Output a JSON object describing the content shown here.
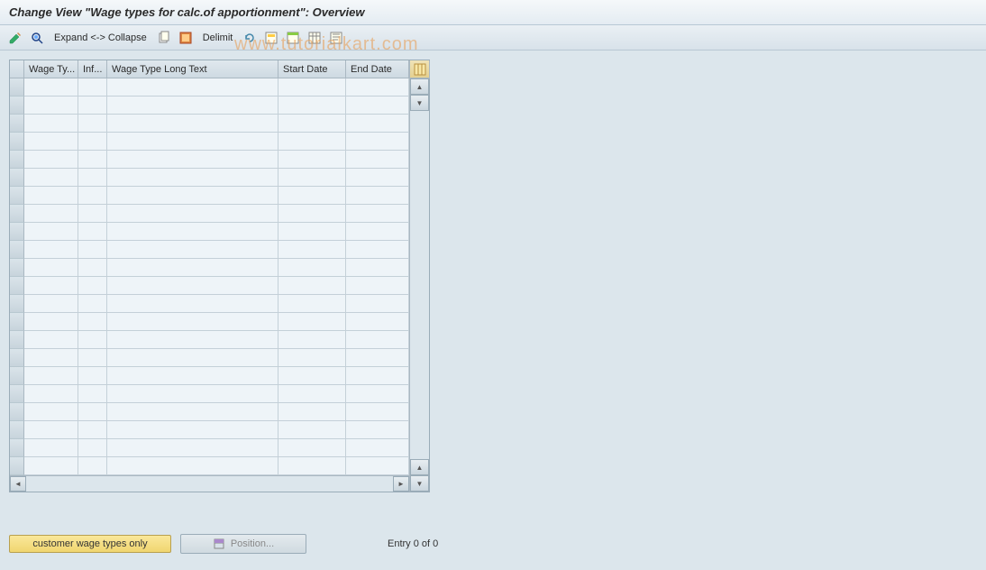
{
  "title": "Change View \"Wage types for calc.of apportionment\": Overview",
  "toolbar": {
    "expand_collapse": "Expand <-> Collapse",
    "delimit": "Delimit"
  },
  "watermark": "www.tutorialkart.com",
  "table": {
    "headers": {
      "wage_type": "Wage Ty...",
      "inf": "Inf...",
      "long_text": "Wage Type Long Text",
      "start_date": "Start Date",
      "end_date": "End Date"
    },
    "row_count": 22
  },
  "footer": {
    "customer_btn": "customer wage types only",
    "position_btn": "Position...",
    "entry_text": "Entry 0 of 0"
  }
}
